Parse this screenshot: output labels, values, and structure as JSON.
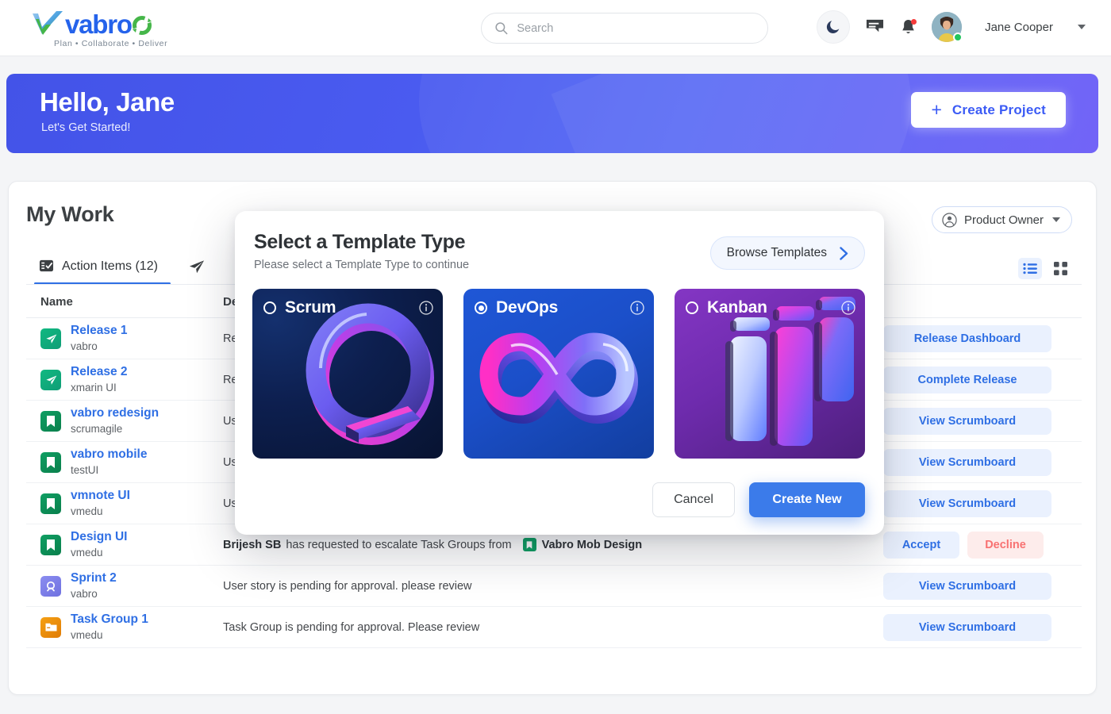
{
  "brand": {
    "name": "vabro",
    "tagline_parts": [
      "Plan",
      "Collaborate",
      "Deliver"
    ],
    "tagline": "Plan • Collaborate • Deliver",
    "primary_color": "#2563eb",
    "accent_green": "#4caf50"
  },
  "header": {
    "search": {
      "value": "",
      "placeholder": "Search"
    },
    "icons": [
      "moon-icon",
      "message-icon",
      "bell-icon"
    ],
    "notification_dot": true,
    "user": {
      "name": "Jane Cooper",
      "status": "online"
    }
  },
  "hero": {
    "greeting": "Hello, Jane",
    "subtitle": "Let's Get Started!",
    "create_button": {
      "plus": "+",
      "label": "Create  Project"
    }
  },
  "main": {
    "title": "My Work",
    "role": {
      "label": "Product Owner"
    },
    "tabs": [
      {
        "label": "Action Items (12)",
        "icon": "action-items-icon",
        "active": true
      },
      {
        "label": "",
        "icon": "paper-plane-icon",
        "active": false
      }
    ],
    "view_modes": [
      {
        "name": "list-view",
        "active": true
      },
      {
        "name": "grid-view",
        "active": false
      }
    ],
    "columns": {
      "name": "Name",
      "description": "De",
      "action": ""
    },
    "rows": [
      {
        "icon": "release-icon",
        "icon_type": "release",
        "name": "Release 1",
        "sub": "vabro",
        "description": "Re",
        "description_bold": "",
        "chip": "",
        "actions": [
          {
            "label": "Release Dashboard",
            "style": "wide"
          }
        ]
      },
      {
        "icon": "release-icon",
        "icon_type": "release",
        "name": "Release 2",
        "sub": "xmarin UI",
        "description": "Re",
        "description_bold": "",
        "chip": "",
        "actions": [
          {
            "label": "Complete Release",
            "style": "wide"
          }
        ]
      },
      {
        "icon": "story-icon",
        "icon_type": "story",
        "name": "vabro redesign",
        "sub": "scrumagile",
        "description": "Us",
        "description_bold": "",
        "chip": "",
        "actions": [
          {
            "label": "View Scrumboard",
            "style": "wide"
          }
        ]
      },
      {
        "icon": "story-icon",
        "icon_type": "story",
        "name": "vabro mobile",
        "sub": "testUI",
        "description": "Us",
        "description_bold": "",
        "chip": "",
        "actions": [
          {
            "label": "View Scrumboard",
            "style": "wide"
          }
        ]
      },
      {
        "icon": "story-icon",
        "icon_type": "story",
        "name": "vmnote UI",
        "sub": "vmedu",
        "description": "User Story is pending for approval. Please review.",
        "description_bold": "",
        "chip": "",
        "actions": [
          {
            "label": "View Scrumboard",
            "style": "wide"
          }
        ]
      },
      {
        "icon": "story-icon",
        "icon_type": "story",
        "name": "Design UI",
        "sub": "vmedu",
        "description": " has requested to escalate Task Groups from",
        "description_bold": "Brijesh SB",
        "chip": "Vabro Mob Design",
        "actions": [
          {
            "label": "Accept",
            "style": "half"
          },
          {
            "label": "Decline",
            "style": "half danger"
          }
        ]
      },
      {
        "icon": "sprint-icon",
        "icon_type": "sprint",
        "name": "Sprint 2",
        "sub": "vabro",
        "description": "User story is pending for approval. please review",
        "description_bold": "",
        "chip": "",
        "actions": [
          {
            "label": "View Scrumboard",
            "style": "wide"
          }
        ]
      },
      {
        "icon": "task-group-icon",
        "icon_type": "task",
        "name": "Task Group 1",
        "sub": "vmedu",
        "description": "Task Group is pending for approval. Please review",
        "description_bold": "",
        "chip": "",
        "actions": [
          {
            "label": "View Scrumboard",
            "style": "wide"
          }
        ]
      }
    ]
  },
  "modal": {
    "title": "Select a Template Type",
    "subtitle": "Please select a Template Type to continue",
    "browse_button": {
      "label": "Browse Templates",
      "icon": "chevron-right-icon"
    },
    "templates": [
      {
        "label": "Scrum",
        "selected": false,
        "theme": "scrum",
        "art": "cycle-arrow-art",
        "info_icon": "info-icon"
      },
      {
        "label": "DevOps",
        "selected": true,
        "theme": "devops",
        "art": "infinity-art",
        "info_icon": "info-icon"
      },
      {
        "label": "Kanban",
        "selected": false,
        "theme": "kanban",
        "art": "kanban-board-art",
        "info_icon": "info-icon"
      }
    ],
    "cancel_label": "Cancel",
    "create_label": "Create New"
  }
}
